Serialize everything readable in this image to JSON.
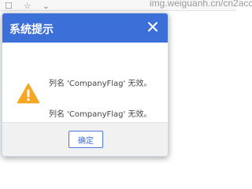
{
  "browser": {
    "url_fragment": "img.weiguanh.cn/cn2acc"
  },
  "dialog": {
    "title": "系统提示",
    "messages": [
      "列名 'CompanyFlag' 无效。",
      "列名 'CompanyFlag' 无效。"
    ],
    "ok_label": "确定",
    "icon": "warning-triangle",
    "colors": {
      "header": "#3d6fd8",
      "warning": "#f5a623",
      "footer": "#f1f1f1"
    }
  }
}
